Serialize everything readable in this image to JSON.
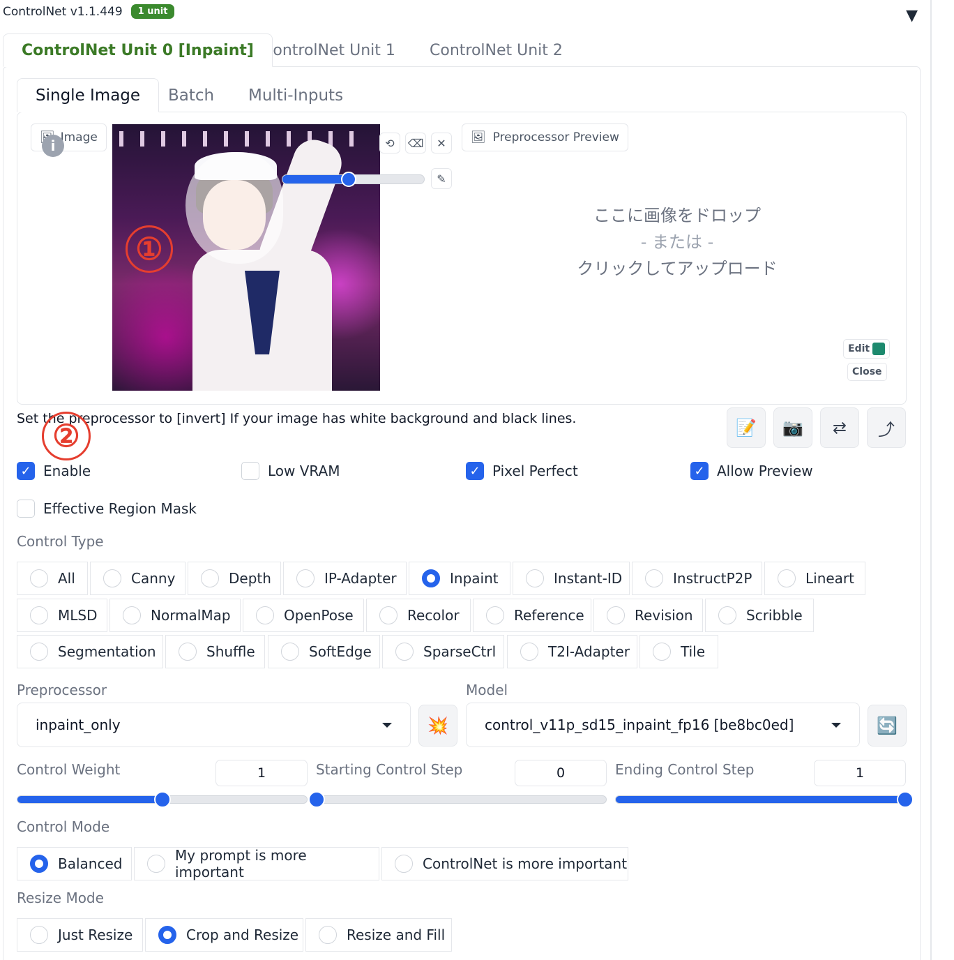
{
  "header": {
    "title": "ControlNet v1.1.449",
    "badge": "1 unit",
    "collapse_icon": "triangle-down-icon"
  },
  "unit_tabs": [
    {
      "label": "ControlNet Unit 0 [Inpaint]",
      "active": true
    },
    {
      "label": "ControlNet Unit 1",
      "active": false
    },
    {
      "label": "ControlNet Unit 2",
      "active": false
    }
  ],
  "image_tabs": [
    {
      "label": "Single Image",
      "active": true
    },
    {
      "label": "Batch",
      "active": false
    },
    {
      "label": "Multi-Inputs",
      "active": false
    }
  ],
  "image_panel": {
    "label": "Image",
    "brush_size_fraction": 0.47,
    "annotation_1": "①",
    "annotation_2": "②"
  },
  "preview_panel": {
    "label": "Preprocessor Preview",
    "drop_line1": "ここに画像をドロップ",
    "drop_line2": "- または -",
    "drop_line3": "クリックしてアップロード",
    "edit_label": "Edit",
    "close_label": "Close"
  },
  "hint": "Set the preprocessor to [invert] If your image has white background and black lines.",
  "checkboxes": {
    "enable": {
      "label": "Enable",
      "checked": true
    },
    "low_vram": {
      "label": "Low VRAM",
      "checked": false
    },
    "pixel_perfect": {
      "label": "Pixel Perfect",
      "checked": true
    },
    "allow_preview": {
      "label": "Allow Preview",
      "checked": true
    },
    "effective_region_mask": {
      "label": "Effective Region Mask",
      "checked": false
    }
  },
  "control_type": {
    "label": "Control Type",
    "options": [
      "All",
      "Canny",
      "Depth",
      "IP-Adapter",
      "Inpaint",
      "Instant-ID",
      "InstructP2P",
      "Lineart",
      "MLSD",
      "NormalMap",
      "OpenPose",
      "Recolor",
      "Reference",
      "Revision",
      "Scribble",
      "Segmentation",
      "Shuffle",
      "SoftEdge",
      "SparseCtrl",
      "T2I-Adapter",
      "Tile"
    ],
    "selected": "Inpaint"
  },
  "preprocessor": {
    "label": "Preprocessor",
    "value": "inpaint_only"
  },
  "model": {
    "label": "Model",
    "value": "control_v11p_sd15_inpaint_fp16 [be8bc0ed]"
  },
  "control_weight": {
    "label": "Control Weight",
    "value": "1",
    "fraction": 0.5
  },
  "starting_step": {
    "label": "Starting Control Step",
    "value": "0",
    "fraction": 0.0
  },
  "ending_step": {
    "label": "Ending Control Step",
    "value": "1",
    "fraction": 1.0
  },
  "control_mode": {
    "label": "Control Mode",
    "options": [
      "Balanced",
      "My prompt is more important",
      "ControlNet is more important"
    ],
    "selected": "Balanced"
  },
  "resize_mode": {
    "label": "Resize Mode",
    "options": [
      "Just Resize",
      "Crop and Resize",
      "Resize and Fill"
    ],
    "selected": "Crop and Resize"
  },
  "colors": {
    "accent": "#2563eb",
    "active_tab": "#3b7a26",
    "badge": "#3b8a2e",
    "annotation": "#e53e2f"
  }
}
